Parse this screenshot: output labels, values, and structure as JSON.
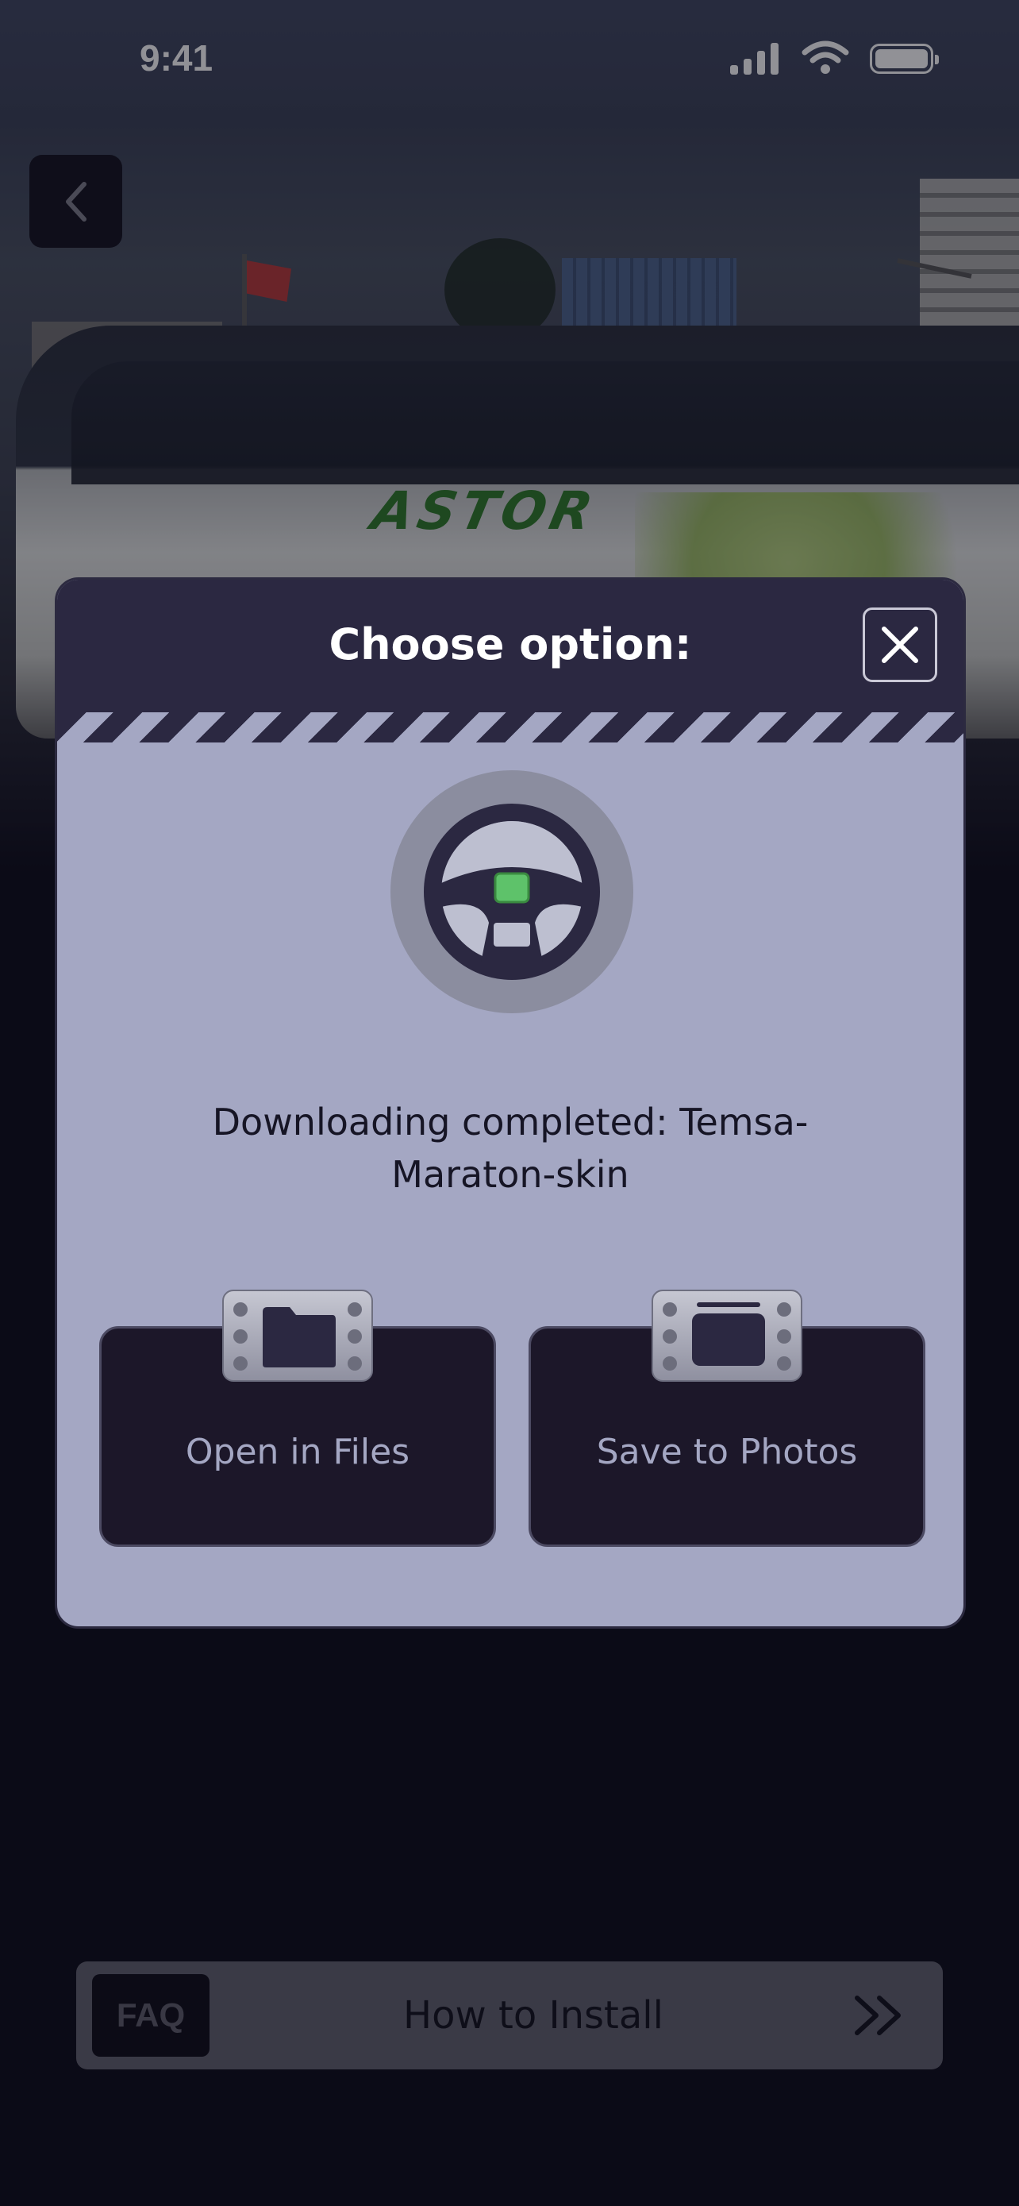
{
  "status_bar": {
    "time": "9:41",
    "signal_icon": "cellular-signal-icon",
    "wifi_icon": "wifi-icon",
    "battery_icon": "battery-icon"
  },
  "nav": {
    "back_icon": "chevron-left-icon"
  },
  "hero": {
    "bus_livery_text": "ASTOR"
  },
  "modal": {
    "title": "Choose option:",
    "close_icon": "close-x-icon",
    "illustration_icon": "steering-wheel-icon",
    "message": "Downloading completed: Temsa-Maraton-skin",
    "actions": [
      {
        "label": "Open in Files",
        "icon": "folder-icon"
      },
      {
        "label": "Save to Photos",
        "icon": "photo-frame-icon"
      }
    ]
  },
  "faq_bar": {
    "badge": "FAQ",
    "title": "How to Install",
    "chevron_icon": "double-chevron-right-icon"
  },
  "colors": {
    "modal_bg": "#a4a7c3",
    "modal_header": "#2b2841",
    "action_card": "#1c1729",
    "steering_wheel": "#2b2841",
    "wheel_button": "#5ec26a",
    "page_bg": "#0c0b18"
  }
}
